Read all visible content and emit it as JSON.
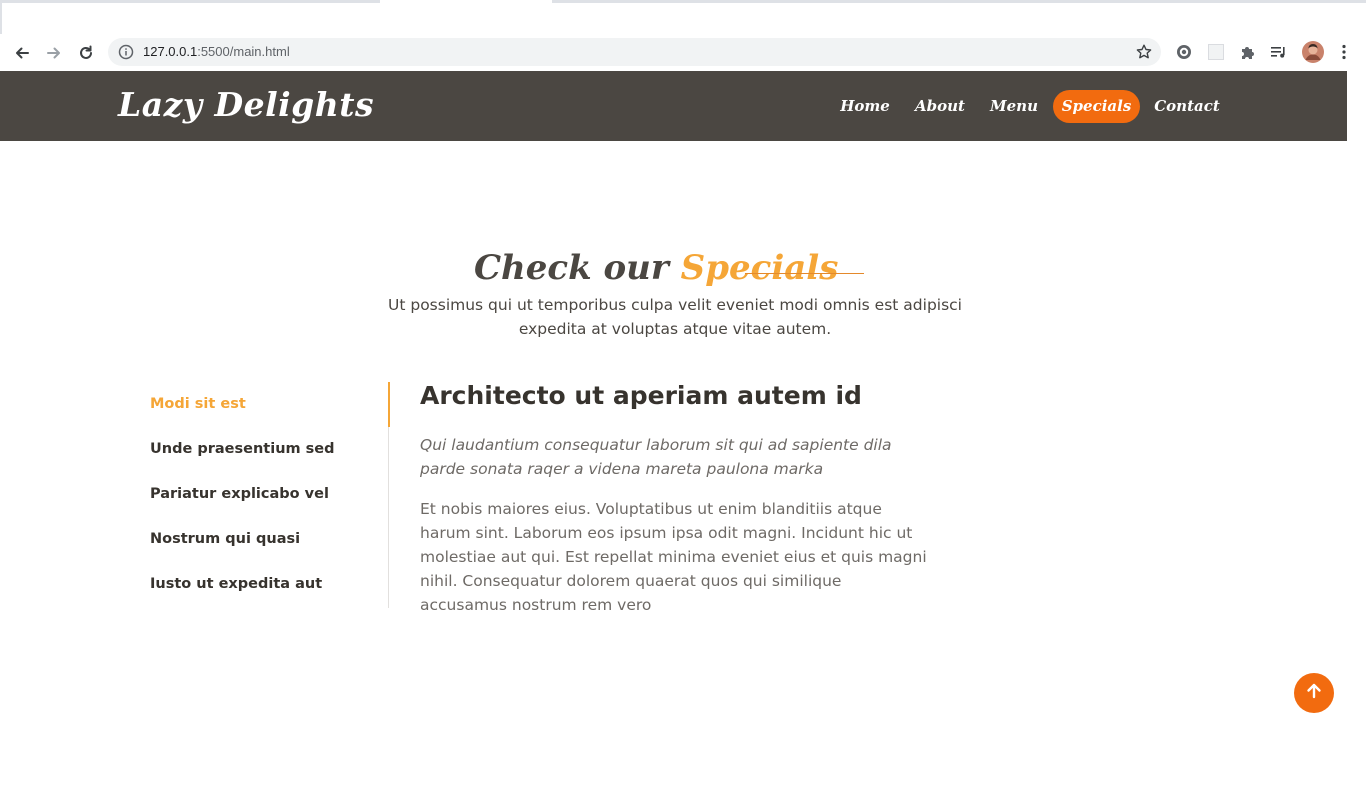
{
  "browser": {
    "url_host": "127.0.0.1",
    "url_rest": ":5500/main.html",
    "icons": [
      "back-arrow-icon",
      "forward-arrow-icon",
      "reload-icon",
      "info-icon",
      "star-icon",
      "extension-gear-icon",
      "extension-blank-icon",
      "puzzle-icon",
      "media-queue-icon",
      "profile-avatar-icon",
      "menu-dots-icon"
    ]
  },
  "header": {
    "logo": "Lazy Delights",
    "nav": [
      {
        "label": "Home"
      },
      {
        "label": "About"
      },
      {
        "label": "Menu"
      },
      {
        "label": "Specials",
        "active": true
      },
      {
        "label": "Contact"
      }
    ],
    "bg_color": "#4b4742",
    "accent_color": "#f26b0f"
  },
  "section": {
    "title_main": "Check our",
    "title_accent": "Specials",
    "subtitle": "Ut possimus qui ut temporibus culpa velit eveniet modi omnis est adipisci expedita at voluptas atque vitae autem.",
    "accent_color": "#f5a637"
  },
  "specials": {
    "tabs": [
      {
        "label": "Modi sit est",
        "active": true
      },
      {
        "label": "Unde praesentium sed"
      },
      {
        "label": "Pariatur explicabo vel"
      },
      {
        "label": "Nostrum qui quasi"
      },
      {
        "label": "Iusto ut expedita aut"
      }
    ],
    "detail": {
      "title": "Architecto ut aperiam autem id",
      "lead": "Qui laudantium consequatur laborum sit qui ad sapiente dila parde sonata raqer a videna mareta paulona marka",
      "body": "Et nobis maiores eius. Voluptatibus ut enim blanditiis atque harum sint. Laborum eos ipsum ipsa odit magni. Incidunt hic ut molestiae aut qui. Est repellat minima eveniet eius et quis magni nihil. Consequatur dolorem quaerat quos qui similique accusamus nostrum rem vero"
    }
  },
  "back_to_top": {
    "icon": "arrow-up-icon"
  }
}
